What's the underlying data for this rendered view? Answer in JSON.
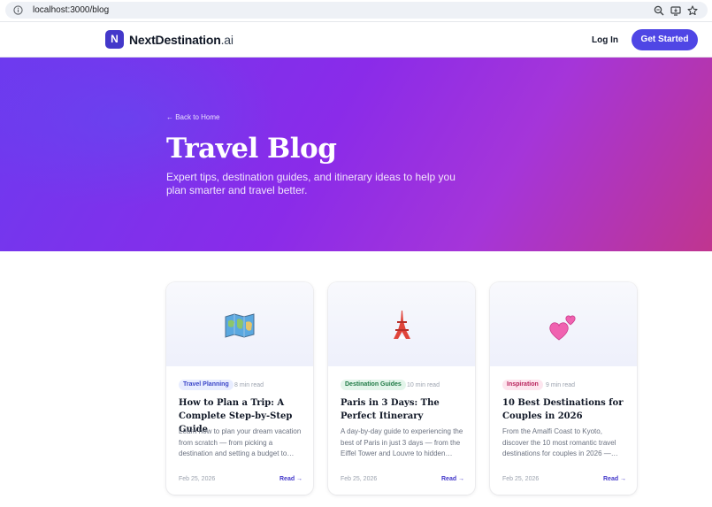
{
  "browser": {
    "url": "localhost:3000/blog"
  },
  "header": {
    "logo_mark": "N",
    "brand_name": "NextDestination",
    "brand_tld": ".ai",
    "login_label": "Log In",
    "cta_label": "Get Started"
  },
  "hero": {
    "back_link": "← Back to Home",
    "title": "Travel Blog",
    "subtitle": "Expert tips, destination guides, and itinerary ideas to help you plan smarter and travel better."
  },
  "posts": [
    {
      "icon": "map-icon",
      "category": "Travel Planning",
      "read_time": "8 min read",
      "title": "How to Plan a Trip: A Complete Step-by-Step Guide",
      "excerpt": "Learn how to plan your dream vacation from scratch — from picking a destination and setting a budget to…",
      "date": "Feb 25, 2026",
      "read_more": "Read →"
    },
    {
      "icon": "eiffel-tower-icon",
      "category": "Destination Guides",
      "read_time": "10 min read",
      "title": "Paris in 3 Days: The Perfect Itinerary",
      "excerpt": "A day-by-day guide to experiencing the best of Paris in just 3 days — from the Eiffel Tower and Louvre to hidden…",
      "date": "Feb 25, 2026",
      "read_more": "Read →"
    },
    {
      "icon": "two-hearts-icon",
      "category": "Inspiration",
      "read_time": "9 min read",
      "title": "10 Best Destinations for Couples in 2026",
      "excerpt": "From the Amalfi Coast to Kyoto, discover the 10 most romantic travel destinations for couples in 2026 —…",
      "date": "Feb 25, 2026",
      "read_more": "Read →"
    }
  ],
  "colors": {
    "brand": "#4f46e5",
    "hero_start": "#6d3aef",
    "hero_end": "#c0358f"
  }
}
